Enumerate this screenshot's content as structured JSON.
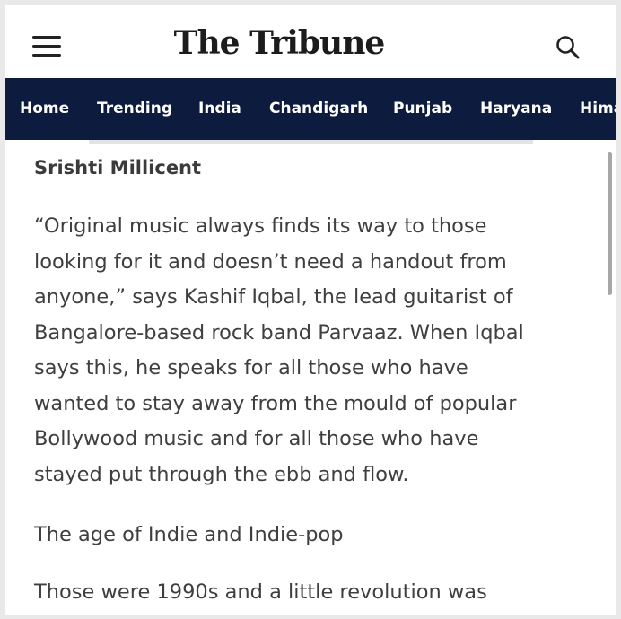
{
  "header": {
    "logo_text": "The Tribune",
    "menu_icon": "hamburger-menu-icon",
    "search_icon": "search-icon"
  },
  "nav": {
    "background": "#0d1b3e",
    "items": [
      {
        "label": "Home"
      },
      {
        "label": "Trending"
      },
      {
        "label": "India"
      },
      {
        "label": "Chandigarh"
      },
      {
        "label": "Punjab"
      },
      {
        "label": "Haryana"
      },
      {
        "label": "Hima"
      }
    ]
  },
  "article": {
    "author": "Srishti Millicent",
    "paragraphs": [
      {
        "lines": [
          "“Original music always finds its way to those",
          "looking for it and doesn’t need a handout from",
          "anyone,” says Kashif Iqbal, the lead guitarist of",
          "Bangalore-based rock band Parvaaz. When Iqbal",
          "says this, he speaks for all those who have",
          "wanted to stay away from the mould of popular",
          "Bollywood music and for all those who have",
          "stayed put through the ebb and flow."
        ]
      },
      {
        "lines": [
          "The age of Indie and Indie-pop"
        ]
      },
      {
        "lines": [
          "Those were 1990s and a little revolution was"
        ]
      }
    ]
  }
}
